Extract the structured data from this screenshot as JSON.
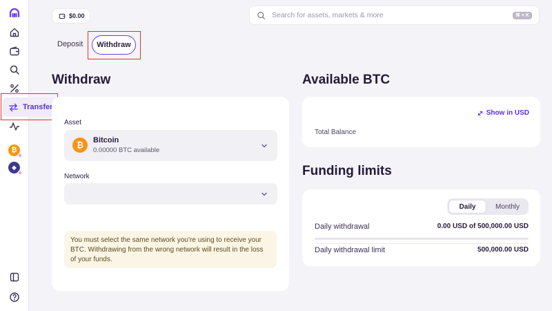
{
  "sidebar": {
    "items": [
      {
        "icon": "kraken-logo-icon"
      },
      {
        "icon": "home-icon"
      },
      {
        "icon": "wallet-icon"
      },
      {
        "icon": "search-icon"
      },
      {
        "icon": "percent-icon"
      },
      {
        "icon": "transfer-icon",
        "label": "Transfer"
      },
      {
        "icon": "activity-icon"
      },
      {
        "icon": "bitcoin-icon",
        "glyph": "₿"
      },
      {
        "icon": "ethereum-icon",
        "glyph": "◆"
      },
      {
        "icon": "panel-toggle-icon"
      },
      {
        "icon": "help-icon"
      }
    ],
    "transfer_label": "Transfer"
  },
  "topbar": {
    "balance": "$0.00",
    "search_placeholder": "Search for assets, markets & more",
    "search_shortcut": "⌘ + K"
  },
  "tabs": {
    "deposit": "Deposit",
    "withdraw": "Withdraw"
  },
  "withdraw": {
    "title": "Withdraw",
    "asset_label": "Asset",
    "asset": {
      "name": "Bitcoin",
      "available": "0.00000 BTC available",
      "glyph": "₿"
    },
    "network_label": "Network",
    "network_value": "",
    "warning": "You must select the same network you’re using to receive your BTC. Withdrawing from the wrong network will result in the loss of your funds."
  },
  "available": {
    "title": "Available BTC",
    "show_in_usd": "Show in USD",
    "total_balance_label": "Total Balance"
  },
  "funding": {
    "title": "Funding limits",
    "toggle": {
      "daily": "Daily",
      "monthly": "Monthly",
      "selected": "Daily"
    },
    "daily_withdrawal_label": "Daily withdrawal",
    "daily_withdrawal_value": "0.00 USD of 500,000.00 USD",
    "daily_withdrawal_progress": 0,
    "daily_limit_label": "Daily withdrawal limit",
    "daily_limit_value": "500,000.00 USD"
  },
  "colors": {
    "accent": "#5b30d9",
    "highlight": "#e0322a",
    "bitcoin": "#f7931a",
    "ethereum": "#3d3a8c"
  }
}
